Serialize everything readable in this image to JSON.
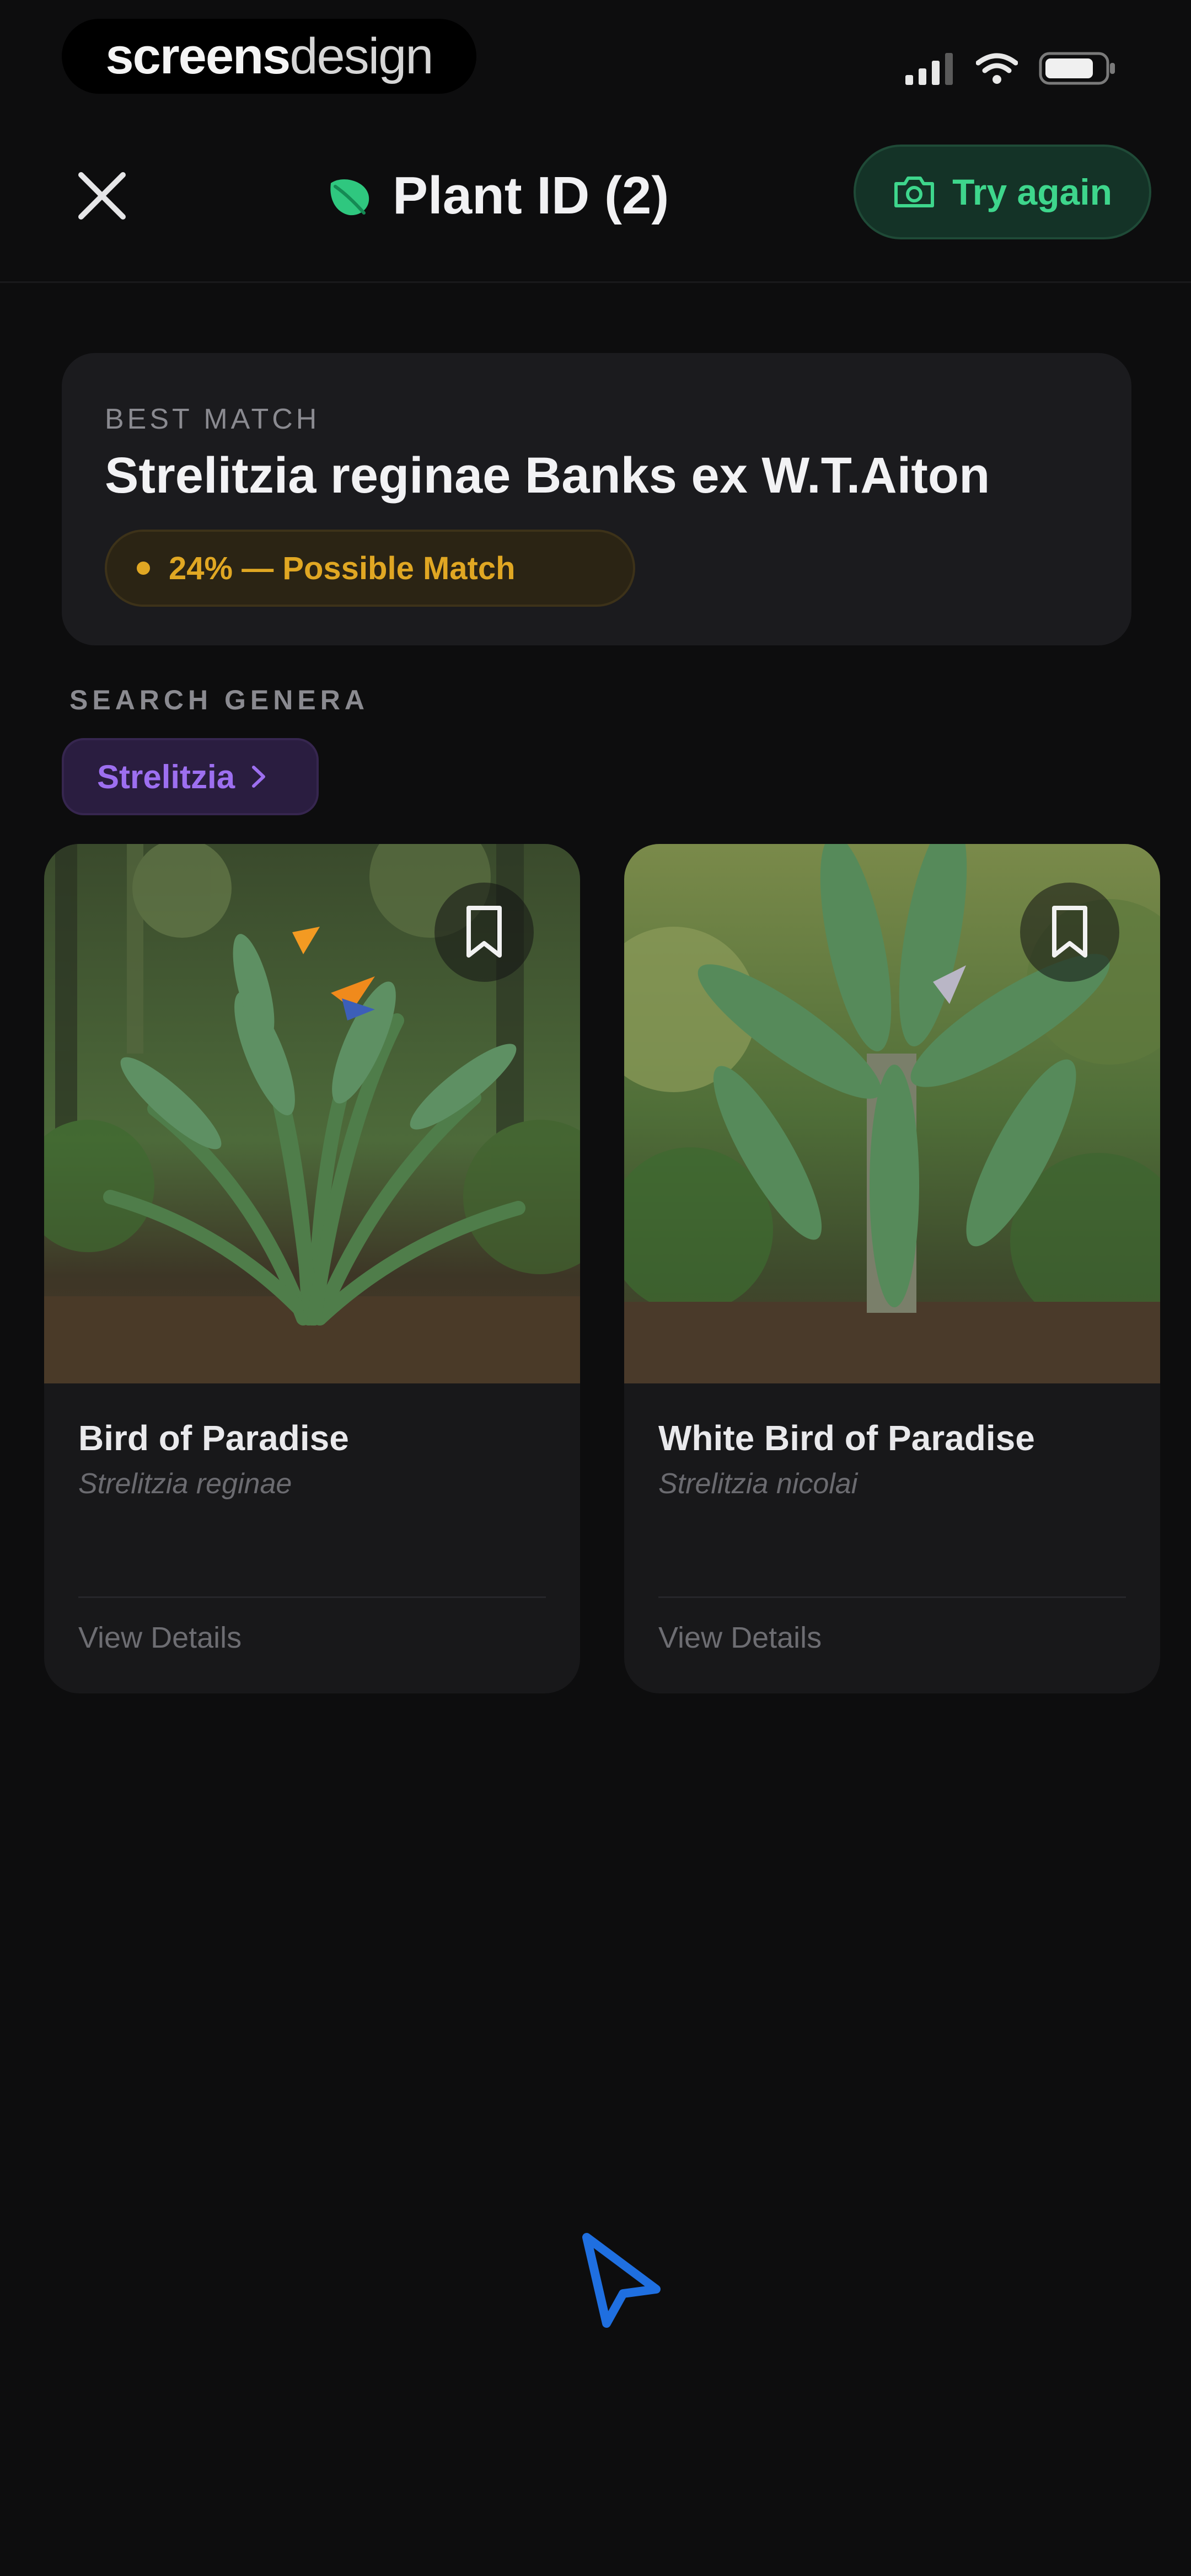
{
  "status_bar": {
    "brand_bold": "screens",
    "brand_light": "design",
    "icons": [
      "signal-icon",
      "wifi-icon",
      "battery-icon"
    ]
  },
  "header": {
    "close_icon": "close-icon",
    "title_icon": "leaf-icon",
    "title": "Plant ID (2)",
    "try_again_icon": "camera-icon",
    "try_again_label": "Try again"
  },
  "best_match": {
    "label": "BEST MATCH",
    "name": "Strelitzia reginae Banks ex W.T.Aiton",
    "badge": "24% — Possible Match",
    "badge_color": "#e0a723"
  },
  "search_genera": {
    "label": "SEARCH GENERA",
    "chips": [
      {
        "label": "Strelitzia",
        "icon": "chevron-right-icon"
      }
    ]
  },
  "results": [
    {
      "common_name": "Bird of Paradise",
      "scientific_name": "Strelitzia reginae",
      "action": "View Details",
      "bookmark_icon": "bookmark-icon"
    },
    {
      "common_name": "White Bird of Paradise",
      "scientific_name": "Strelitzia nicolai",
      "action": "View Details",
      "bookmark_icon": "bookmark-icon"
    }
  ],
  "colors": {
    "background": "#0d0d0e",
    "accent_green": "#3ed68c",
    "genus_purple": "#9d6ff0",
    "cursor_blue": "#1f6fe0"
  }
}
